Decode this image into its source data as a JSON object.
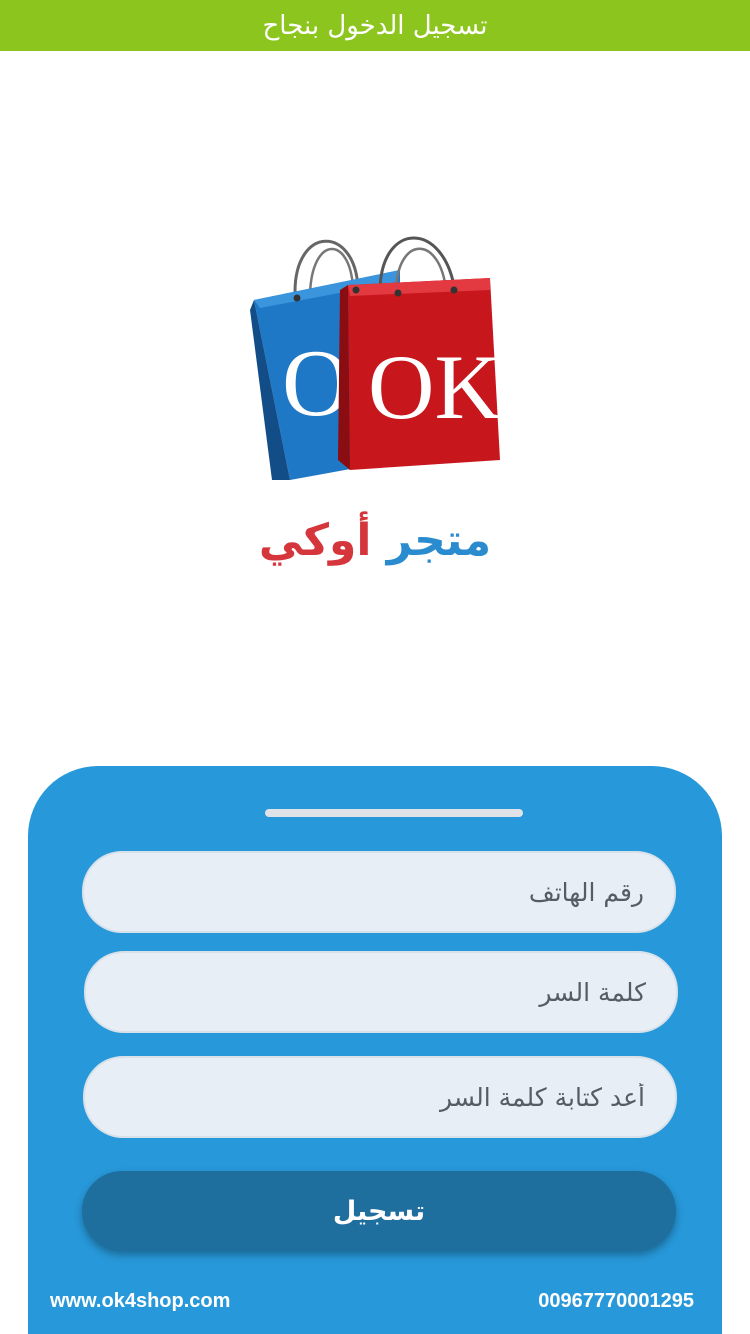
{
  "toast": {
    "message": "تسجيل الدخول بنجاح"
  },
  "brand": {
    "logo_text": "OK",
    "name_part1": "متجر",
    "name_part2": "أوكي"
  },
  "form": {
    "phone_placeholder": "رقم الهاتف",
    "password_placeholder": "كلمة السر",
    "confirm_password_placeholder": "أعد كتابة كلمة السر",
    "submit_label": "تسجيل"
  },
  "footer": {
    "website": "www.ok4shop.com",
    "phone": "00967770001295"
  },
  "colors": {
    "toast_bg": "#8cc51e",
    "sheet_bg": "#2798d9",
    "button_bg": "#1e6e9e",
    "brand_blue": "#2a8bcf",
    "brand_red": "#d5363b"
  }
}
